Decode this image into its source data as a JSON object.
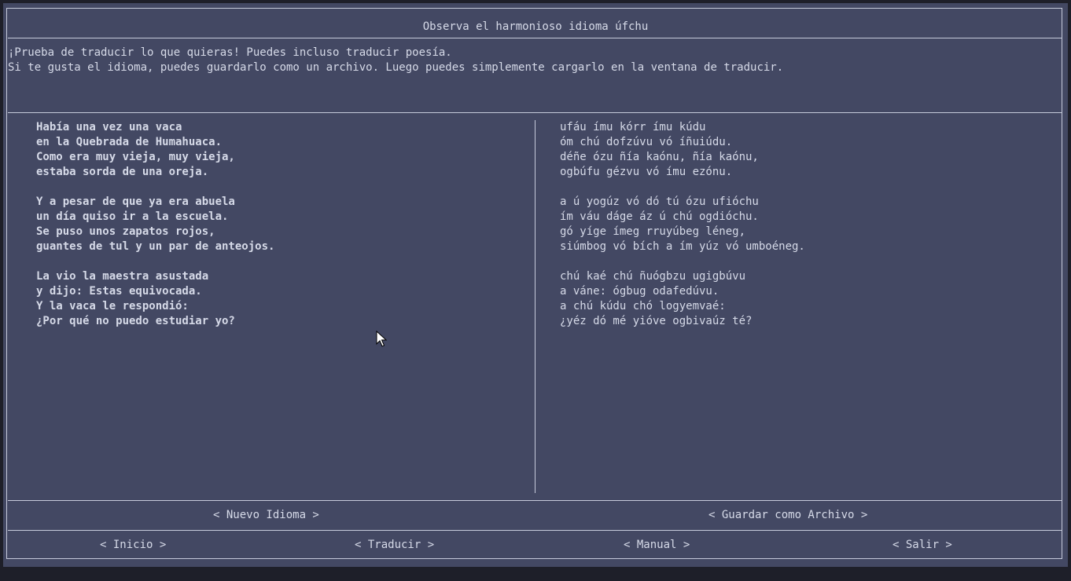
{
  "window": {
    "title": "Observa el harmonioso idioma úfchu"
  },
  "intro": {
    "lines": [
      "¡Prueba de traducir lo que quieras! Puedes incluso traducir poesía.",
      "Si te gusta el idioma, puedes guardarlo como un archivo. Luego puedes simplemente cargarlo en la ventana de traducir."
    ]
  },
  "poem": {
    "original": [
      "Había una vez una vaca",
      "en la Quebrada de Humahuaca.",
      "Como era muy vieja, muy vieja,",
      "estaba sorda de una oreja.",
      "",
      "Y a pesar de que ya era abuela",
      "un día quiso ir a la escuela.",
      "Se puso unos zapatos rojos,",
      "guantes de tul y un par de anteojos.",
      "",
      "La vio la maestra asustada",
      "y dijo: Estas equivocada.",
      "Y la vaca le respondió:",
      "¿Por qué no puedo estudiar yo?"
    ],
    "translated": [
      "ufáu ímu kórr ímu kúdu",
      "óm chú dofzúvu vó íñuiúdu.",
      "déñe ózu ñía kaónu, ñía kaónu,",
      "ogbúfu gézvu vó ímu ezónu.",
      "",
      "a ú yogúz vó dó tú ózu ufióchu",
      "ím váu dáge áz ú chú ogdióchu.",
      "gó yíge ímeg rruyúbeg léneg,",
      "siúmbog vó bích a ím yúz vó umboéneg.",
      "",
      "chú kaé chú ñuógbzu ugigbúvu",
      "a váne: ógbug odafedúvu.",
      "a chú kúdu chó logyemvaé:",
      "¿yéz dó mé yióve ogbivaúz té?"
    ]
  },
  "actions": {
    "new_language": "< Nuevo Idioma >",
    "save_file": "< Guardar como Archivo >"
  },
  "nav": {
    "home": "< Inicio >",
    "translate": "< Traducir >",
    "manual": "< Manual >",
    "exit": "< Salir >"
  }
}
